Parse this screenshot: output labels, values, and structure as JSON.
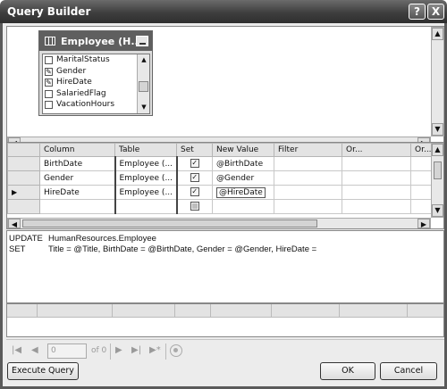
{
  "window": {
    "title": "Query Builder",
    "help_label": "?",
    "close_label": "X"
  },
  "diagram": {
    "table_title": "Employee (H...",
    "columns": [
      {
        "name": "MaritalStatus",
        "checked": false
      },
      {
        "name": "Gender",
        "checked": true
      },
      {
        "name": "HireDate",
        "checked": true
      },
      {
        "name": "SalariedFlag",
        "checked": false
      },
      {
        "name": "VacationHours",
        "checked": false
      }
    ]
  },
  "grid": {
    "headers": [
      "Column",
      "Table",
      "Set",
      "New Value",
      "Filter",
      "Or...",
      "Or..."
    ],
    "rows": [
      {
        "column": "BirthDate",
        "table": "Employee (...",
        "set": true,
        "new_value": "@BirthDate",
        "current": false
      },
      {
        "column": "Gender",
        "table": "Employee (...",
        "set": true,
        "new_value": "@Gender",
        "current": false
      },
      {
        "column": "HireDate",
        "table": "Employee (...",
        "set": true,
        "new_value": "@HireDate",
        "current": true
      },
      {
        "column": "",
        "table": "",
        "set": false,
        "new_value": "",
        "current": false
      }
    ]
  },
  "sql": {
    "line1_keyword": "UPDATE",
    "line1_text": "HumanResources.Employee",
    "line2_keyword": "SET",
    "line2_text": "Title = @Title, BirthDate = @BirthDate, Gender = @Gender, HireDate ="
  },
  "navigator": {
    "page_value": "0",
    "of_text": "of 0"
  },
  "buttons": {
    "execute": "Execute Query",
    "ok": "OK",
    "cancel": "Cancel"
  }
}
